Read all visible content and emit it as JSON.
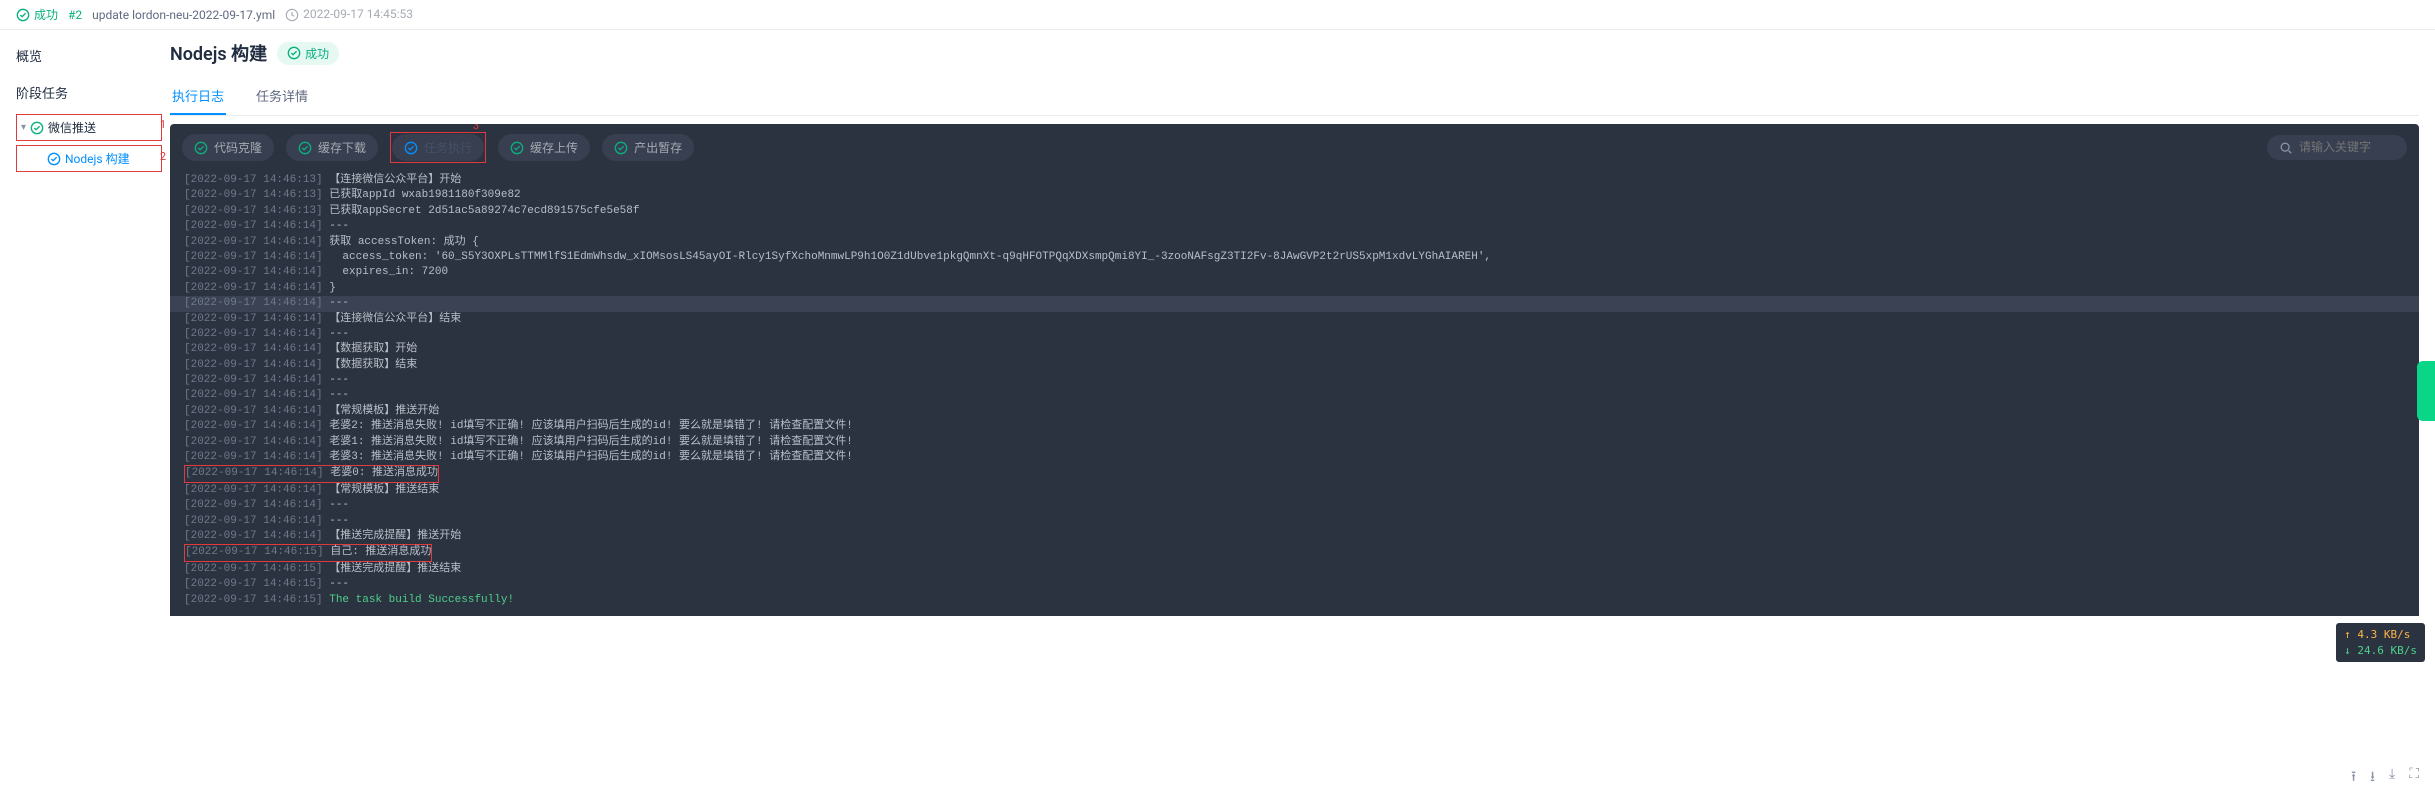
{
  "header": {
    "status_text": "成功",
    "run_number": "#2",
    "title": "update lordon-neu-2022-09-17.yml",
    "timestamp": "2022-09-17 14:45:53"
  },
  "annotations": {
    "n1": "1",
    "n2": "2",
    "n3": "3"
  },
  "sidebar": {
    "overview": "概览",
    "stage_tasks": "阶段任务",
    "items": [
      {
        "label": "微信推送"
      },
      {
        "label": "Nodejs 构建"
      }
    ]
  },
  "page": {
    "title": "Nodejs 构建",
    "badge": "成功"
  },
  "tabs": [
    {
      "label": "执行日志",
      "active": true
    },
    {
      "label": "任务详情",
      "active": false
    }
  ],
  "pills": [
    {
      "label": "代码克隆"
    },
    {
      "label": "缓存下载"
    },
    {
      "label": "任务执行"
    },
    {
      "label": "缓存上传"
    },
    {
      "label": "产出暂存"
    }
  ],
  "search": {
    "placeholder": "请输入关键字"
  },
  "log_lines": [
    {
      "ts": "[2022-09-17 14:46:13]",
      "msg": "【连接微信公众平台】开始"
    },
    {
      "ts": "[2022-09-17 14:46:13]",
      "msg": "已获取appId wxab1981180f309e82"
    },
    {
      "ts": "[2022-09-17 14:46:13]",
      "msg": "已获取appSecret 2d51ac5a89274c7ecd891575cfe5e58f"
    },
    {
      "ts": "[2022-09-17 14:46:14]",
      "msg": "---"
    },
    {
      "ts": "[2022-09-17 14:46:14]",
      "msg": "获取 accessToken: 成功 {"
    },
    {
      "ts": "[2022-09-17 14:46:14]",
      "msg": "  access_token: '60_S5Y3OXPLsTTMMlfS1EdmWhsdw_xIOMsosLS45ayOI-Rlcy1SyfXchoMnmwLP9h1O0Z1dUbve1pkgQmnXt-q9qHFOTPQqXDXsmpQmi8YI_-3zooNAFsgZ3TI2Fv-8JAwGVP2t2rUS5xpM1xdvLYGhAIAREH',"
    },
    {
      "ts": "[2022-09-17 14:46:14]",
      "msg": "  expires_in: 7200"
    },
    {
      "ts": "[2022-09-17 14:46:14]",
      "msg": "}"
    },
    {
      "ts": "[2022-09-17 14:46:14]",
      "msg": "---",
      "hl": true
    },
    {
      "ts": "[2022-09-17 14:46:14]",
      "msg": "【连接微信公众平台】结束"
    },
    {
      "ts": "[2022-09-17 14:46:14]",
      "msg": "---"
    },
    {
      "ts": "[2022-09-17 14:46:14]",
      "msg": "【数据获取】开始"
    },
    {
      "ts": "[2022-09-17 14:46:14]",
      "msg": "【数据获取】结束"
    },
    {
      "ts": "[2022-09-17 14:46:14]",
      "msg": "---"
    },
    {
      "ts": "[2022-09-17 14:46:14]",
      "msg": "---"
    },
    {
      "ts": "[2022-09-17 14:46:14]",
      "msg": "【常规模板】推送开始"
    },
    {
      "ts": "[2022-09-17 14:46:14]",
      "msg": "老婆2: 推送消息失败! id填写不正确! 应该填用户扫码后生成的id! 要么就是填错了! 请检查配置文件!"
    },
    {
      "ts": "[2022-09-17 14:46:14]",
      "msg": "老婆1: 推送消息失败! id填写不正确! 应该填用户扫码后生成的id! 要么就是填错了! 请检查配置文件!"
    },
    {
      "ts": "[2022-09-17 14:46:14]",
      "msg": "老婆3: 推送消息失败! id填写不正确! 应该填用户扫码后生成的id! 要么就是填错了! 请检查配置文件!"
    },
    {
      "ts": "[2022-09-17 14:46:14]",
      "msg": "老婆0: 推送消息成功",
      "redbox": true
    },
    {
      "ts": "[2022-09-17 14:46:14]",
      "msg": "【常规模板】推送结束"
    },
    {
      "ts": "[2022-09-17 14:46:14]",
      "msg": "---"
    },
    {
      "ts": "[2022-09-17 14:46:14]",
      "msg": "---"
    },
    {
      "ts": "[2022-09-17 14:46:14]",
      "msg": "【推送完成提醒】推送开始"
    },
    {
      "ts": "[2022-09-17 14:46:15]",
      "msg": "自己: 推送消息成功",
      "redbox": true
    },
    {
      "ts": "[2022-09-17 14:46:15]",
      "msg": "【推送完成提醒】推送结束"
    },
    {
      "ts": "[2022-09-17 14:46:15]",
      "msg": "---"
    },
    {
      "ts": "[2022-09-17 14:46:15]",
      "msg": "The task build Successfully!",
      "green": true
    }
  ],
  "speed": {
    "up": "↑ 4.3 KB/s",
    "down": "↓ 24.6 KB/s"
  }
}
